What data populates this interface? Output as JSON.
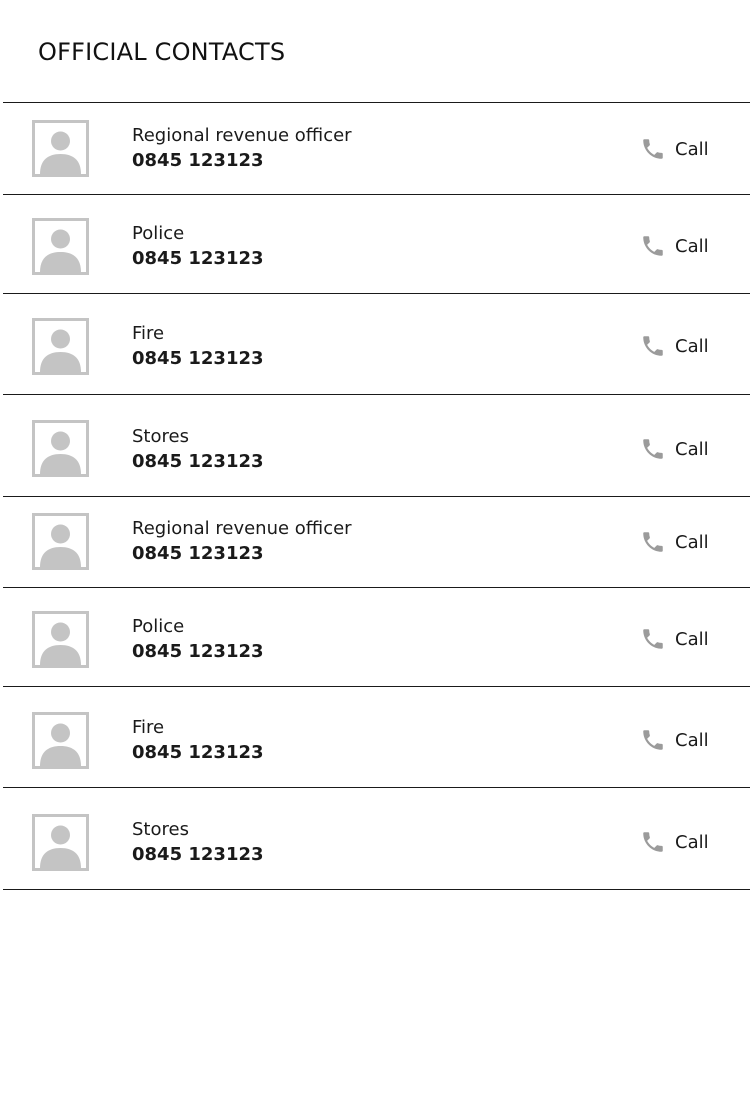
{
  "page": {
    "title": "OFFICIAL CONTACTS"
  },
  "contacts": [
    {
      "name": "Regional revenue officer",
      "phone": "0845 123123",
      "action_label": "Call",
      "avatar_icon": "person-silhouette-icon",
      "action_icon": "phone-icon"
    },
    {
      "name": "Police",
      "phone": "0845 123123",
      "action_label": "Call",
      "avatar_icon": "person-silhouette-icon",
      "action_icon": "phone-icon"
    },
    {
      "name": "Fire",
      "phone": "0845 123123",
      "action_label": "Call",
      "avatar_icon": "person-silhouette-icon",
      "action_icon": "phone-icon"
    },
    {
      "name": "Stores",
      "phone": "0845 123123",
      "action_label": "Call",
      "avatar_icon": "person-silhouette-icon",
      "action_icon": "phone-icon"
    },
    {
      "name": "Regional revenue officer",
      "phone": "0845 123123",
      "action_label": "Call",
      "avatar_icon": "person-silhouette-icon",
      "action_icon": "phone-icon"
    },
    {
      "name": "Police",
      "phone": "0845 123123",
      "action_label": "Call",
      "avatar_icon": "person-silhouette-icon",
      "action_icon": "phone-icon"
    },
    {
      "name": "Fire",
      "phone": "0845 123123",
      "action_label": "Call",
      "avatar_icon": "person-silhouette-icon",
      "action_icon": "phone-icon"
    },
    {
      "name": "Stores",
      "phone": "0845 123123",
      "action_label": "Call",
      "avatar_icon": "person-silhouette-icon",
      "action_icon": "phone-icon"
    }
  ],
  "colors": {
    "text": "#1a1a1a",
    "divider": "#1a1a1a",
    "icon_gray": "#9b9b9b",
    "avatar_border": "#c4c4c4",
    "avatar_fill": "#c4c4c4"
  }
}
